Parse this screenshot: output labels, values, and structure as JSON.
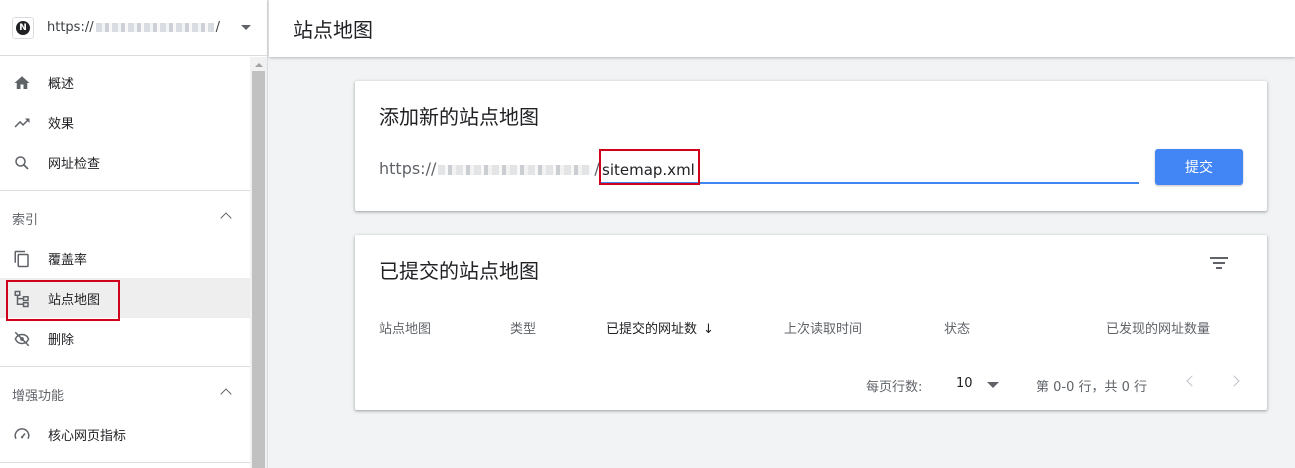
{
  "property": {
    "logo_letter": "N",
    "url_prefix": "https://",
    "url_suffix": "/"
  },
  "sidebar": {
    "overview": "概述",
    "performance": "效果",
    "url_inspection": "网址检查",
    "index_section": "索引",
    "coverage": "覆盖率",
    "sitemaps": "站点地图",
    "removals": "删除",
    "enhancements_section": "增强功能",
    "core_web_vitals": "核心网页指标"
  },
  "header": {
    "title": "站点地图"
  },
  "add_card": {
    "title": "添加新的站点地图",
    "url_prefix": "https://",
    "url_suffix": "/",
    "input_value": "sitemap.xml",
    "submit_label": "提交"
  },
  "submitted_card": {
    "title": "已提交的站点地图",
    "columns": [
      "站点地图",
      "类型",
      "已提交的网址数",
      "上次读取时间",
      "状态",
      "已发现的网址数量"
    ],
    "sort_arrow": "↓",
    "rows_per_page_label": "每页行数:",
    "rows_per_page_value": "10",
    "range_text": "第 0-0 行，共 0 行"
  },
  "colors": {
    "accent": "#4285f4",
    "highlight": "#d0021b"
  }
}
